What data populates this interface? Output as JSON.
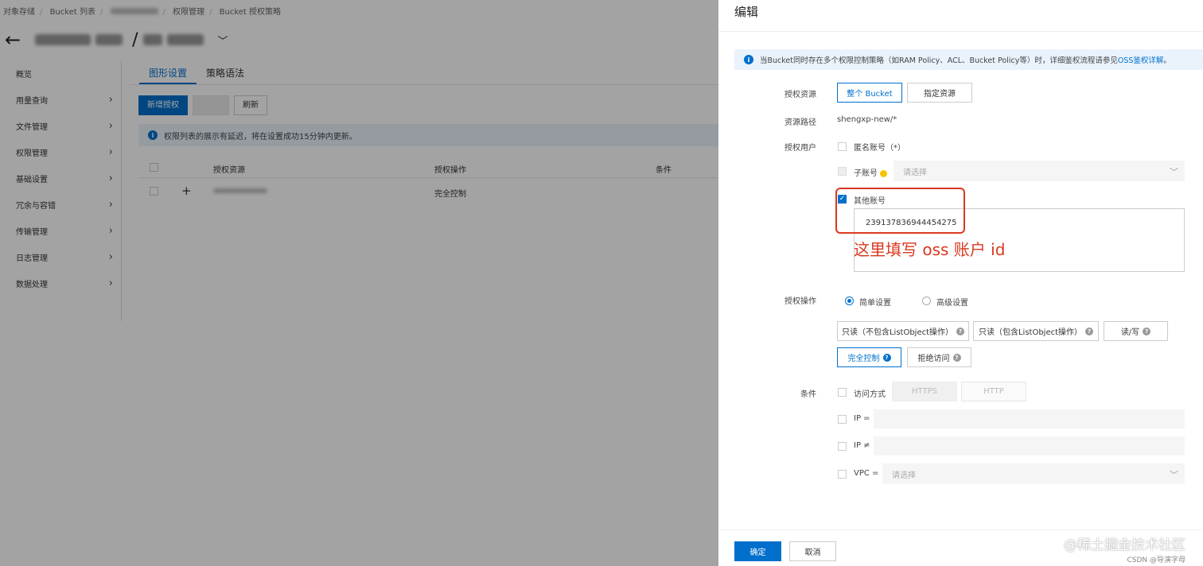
{
  "breadcrumb": {
    "items": [
      "对象存储",
      "Bucket 列表",
      "",
      "权限管理",
      "Bucket 授权策略"
    ]
  },
  "sidebar": {
    "items": [
      {
        "label": "概览"
      },
      {
        "label": "用量查询"
      },
      {
        "label": "文件管理"
      },
      {
        "label": "权限管理"
      },
      {
        "label": "基础设置"
      },
      {
        "label": "冗余与容错"
      },
      {
        "label": "传输管理"
      },
      {
        "label": "日志管理"
      },
      {
        "label": "数据处理"
      }
    ]
  },
  "main": {
    "tabs": [
      {
        "label": "图形设置",
        "active": true
      },
      {
        "label": "策略语法",
        "active": false
      }
    ],
    "toolbar": {
      "add_label": "新增授权",
      "refresh_label": "刷新"
    },
    "notice": "权限列表的展示有延迟，将在设置成功15分钟内更新。",
    "table": {
      "headers": [
        "授权资源",
        "授权操作",
        "条件"
      ],
      "rows": [
        {
          "resource": "",
          "action": "完全控制"
        }
      ]
    }
  },
  "drawer": {
    "title": "编辑",
    "notice_prefix": "当Bucket同时存在多个权限控制策略（如RAM Policy、ACL、Bucket Policy等）时，详细鉴权流程请参见",
    "notice_link": "OSS鉴权详解",
    "notice_suffix": "。",
    "resource": {
      "label": "授权资源",
      "options": [
        "整个 Bucket",
        "指定资源"
      ],
      "selected": "整个 Bucket"
    },
    "path": {
      "label": "资源路径",
      "value": "shengxp-new/*"
    },
    "user": {
      "label": "授权用户",
      "anonymous_label": "匿名账号（*）",
      "sub_label": "子账号",
      "sub_placeholder": "请选择",
      "other_label": "其他账号",
      "other_value": "239137836944454275"
    },
    "annotation": "这里填写 oss 账户 id",
    "operation": {
      "label": "授权操作",
      "simple_label": "简单设置",
      "advanced_label": "高级设置",
      "mode": "简单设置",
      "buttons": [
        "只读（不包含ListObject操作）",
        "只读（包含ListObject操作）",
        "读/写",
        "完全控制",
        "拒绝访问"
      ],
      "selected": "完全控制"
    },
    "conditions": {
      "label": "条件",
      "access_label": "访问方式",
      "https_label": "HTTPS",
      "http_label": "HTTP",
      "ip_eq_label": "IP =",
      "ip_ne_label": "IP ≠",
      "vpc_label": "VPC =",
      "vpc_placeholder": "请选择"
    },
    "footer": {
      "confirm_label": "确定",
      "cancel_label": "取消"
    }
  },
  "watermark": {
    "main": "@稀土掘金技术社区",
    "sub": "CSDN @导演字母"
  },
  "colors": {
    "accent": "#0070cc",
    "annotation": "#d9381e",
    "warning": "#f5c400"
  }
}
